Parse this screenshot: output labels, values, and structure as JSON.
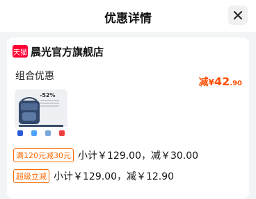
{
  "header": {
    "title": "优惠详情"
  },
  "store": {
    "badge": "天猫",
    "name": "晨光官方旗舰店"
  },
  "combo": {
    "title": "组合优惠",
    "discount_label": "减",
    "currency": "¥",
    "amount_int": "42",
    "amount_dec": ".90"
  },
  "product": {
    "badge": "-52%"
  },
  "promotions": [
    {
      "tag": "满120元减30元",
      "text": "小计￥129.00，减￥30.00"
    },
    {
      "tag": "超级立减",
      "text": "小计￥129.00，减￥12.90"
    }
  ],
  "colors": {
    "accent": "#ff4d00",
    "tmall": "#ff0036",
    "tag_border": "#ff6a00"
  }
}
